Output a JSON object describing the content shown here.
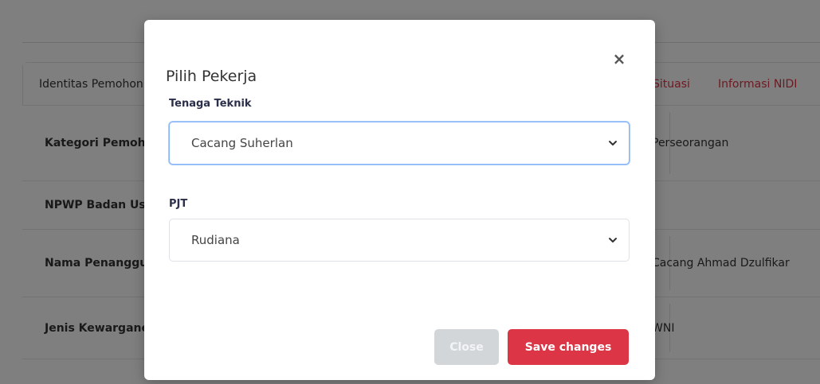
{
  "background": {
    "tabs": [
      {
        "label": "Identitas Pemohon"
      },
      {
        "label": "Situasi"
      },
      {
        "label": "Informasi NIDI"
      }
    ],
    "rows": [
      {
        "label": "Kategori Pemohon",
        "value": "Perseorangan"
      },
      {
        "label": "NPWP Badan Usaha",
        "value": ""
      },
      {
        "label": "Nama Penanggung Jawab",
        "value": "Cacang Ahmad Dzulfikar"
      },
      {
        "label": "Jenis Kewarganegaraan",
        "value": "WNI"
      },
      {
        "label": "",
        "value": ""
      }
    ]
  },
  "modal": {
    "title": "Pilih Pekerja",
    "close_glyph": "×",
    "fields": [
      {
        "label": "Tenaga Teknik",
        "selected": "Cacang Suherlan"
      },
      {
        "label": "PJT",
        "selected": "Rudiana"
      }
    ],
    "buttons": {
      "close": "Close",
      "save": "Save changes"
    }
  },
  "colors": {
    "accent": "#dc3545",
    "focus_border": "#86b7fe",
    "disabled_button": "#d3d6d9"
  }
}
